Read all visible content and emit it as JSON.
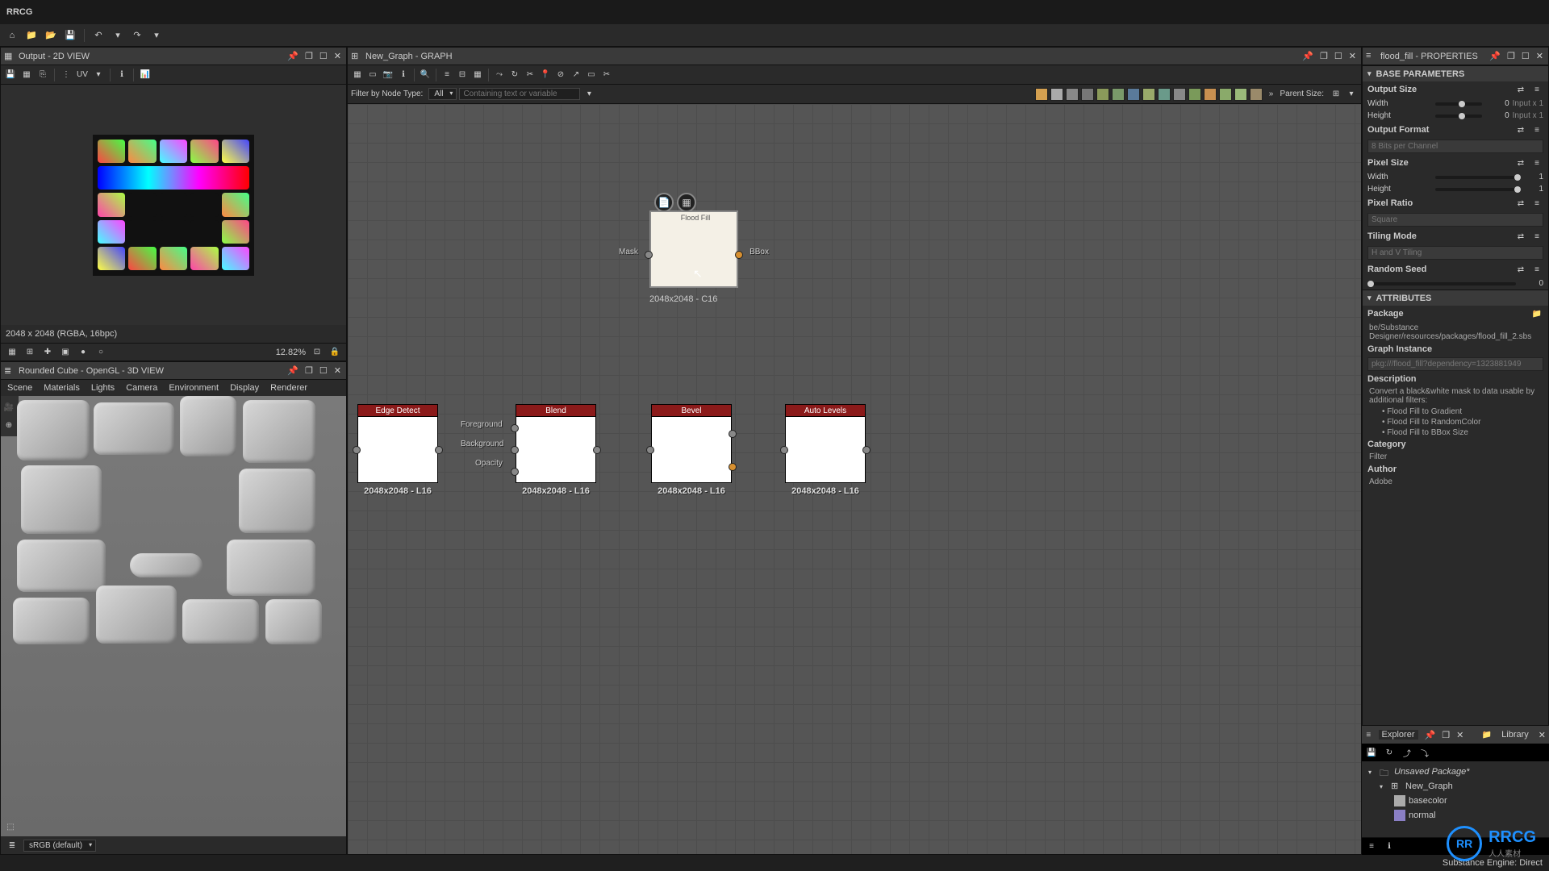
{
  "app": {
    "title": "RRCG"
  },
  "panels": {
    "output2d": {
      "title": "Output - 2D VIEW",
      "status": "2048 x 2048 (RGBA, 16bpc)",
      "zoom": "12.82%",
      "uv_label": "UV"
    },
    "view3d": {
      "title": "Rounded Cube - OpenGL - 3D VIEW",
      "menu": [
        "Scene",
        "Materials",
        "Lights",
        "Camera",
        "Environment",
        "Display",
        "Renderer"
      ],
      "colorspace": "sRGB (default)"
    },
    "graph": {
      "title": "New_Graph - GRAPH",
      "filter_label": "Filter by Node Type:",
      "filter_value": "All",
      "search_placeholder": "Containing text or variable",
      "parent_size_label": "Parent Size:"
    },
    "properties": {
      "title": "flood_fill - PROPERTIES"
    },
    "explorer": {
      "title": "Explorer"
    },
    "library": {
      "title": "Library"
    }
  },
  "graph_nodes": {
    "flood_fill": {
      "label": "Flood Fill",
      "resolution": "2048x2048 - C16",
      "in_label": "Mask",
      "out_label": "BBox"
    },
    "edge_detect": {
      "label": "Edge Detect",
      "resolution": "2048x2048 - L16"
    },
    "blend": {
      "label": "Blend",
      "resolution": "2048x2048 - L16",
      "in_labels": [
        "Foreground",
        "Background",
        "Opacity"
      ]
    },
    "bevel": {
      "label": "Bevel",
      "resolution": "2048x2048 - L16"
    },
    "auto_levels": {
      "label": "Auto Levels",
      "resolution": "2048x2048 - L16"
    }
  },
  "properties": {
    "sections": {
      "base_params": "BASE PARAMETERS",
      "attributes": "ATTRIBUTES"
    },
    "output_size": {
      "label": "Output Size",
      "width_label": "Width",
      "height_label": "Height",
      "width_val": "0",
      "height_val": "0",
      "width_mult": "Input x 1",
      "height_mult": "Input x 1"
    },
    "output_format": {
      "label": "Output Format",
      "value": "8 Bits per Channel"
    },
    "pixel_size": {
      "label": "Pixel Size",
      "width_label": "Width",
      "height_label": "Height",
      "width_val": "1",
      "height_val": "1"
    },
    "pixel_ratio": {
      "label": "Pixel Ratio",
      "value": "Square"
    },
    "tiling_mode": {
      "label": "Tiling Mode",
      "value": "H and V Tiling"
    },
    "random_seed": {
      "label": "Random Seed",
      "value": "0"
    },
    "package": {
      "label": "Package",
      "value": "be/Substance Designer/resources/packages/flood_fill_2.sbs"
    },
    "graph_instance": {
      "label": "Graph Instance",
      "value": "pkg:///flood_fill?dependency=1323881949"
    },
    "description": {
      "label": "Description",
      "text": "Convert a black&white mask to data usable by additional filters:",
      "bullets": [
        "Flood Fill to Gradient",
        "Flood Fill to RandomColor",
        "Flood Fill to BBox Size"
      ]
    },
    "category": {
      "label": "Category",
      "value": "Filter"
    },
    "author": {
      "label": "Author",
      "value": "Adobe"
    }
  },
  "explorer": {
    "package": "Unsaved Package*",
    "graph": "New_Graph",
    "outputs": [
      "basecolor",
      "normal"
    ]
  },
  "statusbar": {
    "text": "Substance Engine: Direct"
  },
  "logo": {
    "text": "RRCG",
    "sub": "人人素材"
  }
}
